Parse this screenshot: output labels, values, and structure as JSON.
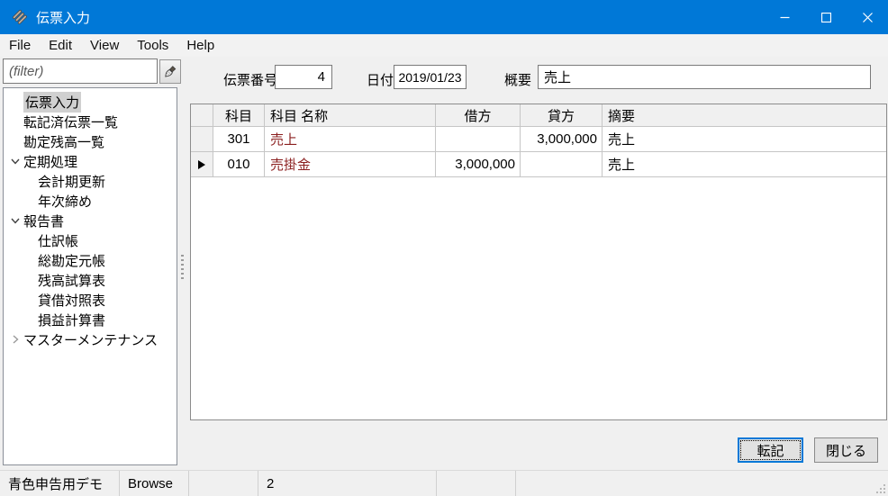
{
  "window": {
    "title": "伝票入力"
  },
  "menu": {
    "items": [
      "File",
      "Edit",
      "View",
      "Tools",
      "Help"
    ]
  },
  "sidebar": {
    "filter_placeholder": "(filter)",
    "tree": [
      {
        "label": "伝票入力",
        "selected": true
      },
      {
        "label": "転記済伝票一覧"
      },
      {
        "label": "勘定残高一覧"
      },
      {
        "label": "定期処理",
        "state": "expanded"
      },
      {
        "label": "会計期更新"
      },
      {
        "label": "年次締め"
      },
      {
        "label": "報告書",
        "state": "expanded"
      },
      {
        "label": "仕訳帳"
      },
      {
        "label": "総勘定元帳"
      },
      {
        "label": "残高試算表"
      },
      {
        "label": "貸借対照表"
      },
      {
        "label": "損益計算書"
      },
      {
        "label": "マスターメンテナンス",
        "state": "collapsed"
      }
    ]
  },
  "form": {
    "voucher_no_label": "伝票番号",
    "voucher_no_value": "4",
    "date_label": "日付",
    "date_value": "2019/01/23",
    "summary_label": "概要",
    "summary_value": "売上"
  },
  "grid": {
    "columns": [
      "",
      "科目",
      "科目 名称",
      "借方",
      "貸方",
      "摘要"
    ],
    "rows": [
      {
        "current": false,
        "code": "301",
        "name": "売上",
        "debit": "",
        "credit": "3,000,000",
        "memo": "売上"
      },
      {
        "current": true,
        "code": "010",
        "name": "売掛金",
        "debit": "3,000,000",
        "credit": "",
        "memo": "売上"
      }
    ]
  },
  "buttons": {
    "post_label": "転記",
    "close_label": "閉じる"
  },
  "statusbar": {
    "cells": [
      "青色申告用デモ",
      "Browse",
      "",
      "2",
      "",
      ""
    ]
  },
  "colors": {
    "titlebar": "#0078d7",
    "accent": "#0078d7",
    "account_name": "#8b1f1f",
    "selection_inactive": "#d0d0d0"
  }
}
